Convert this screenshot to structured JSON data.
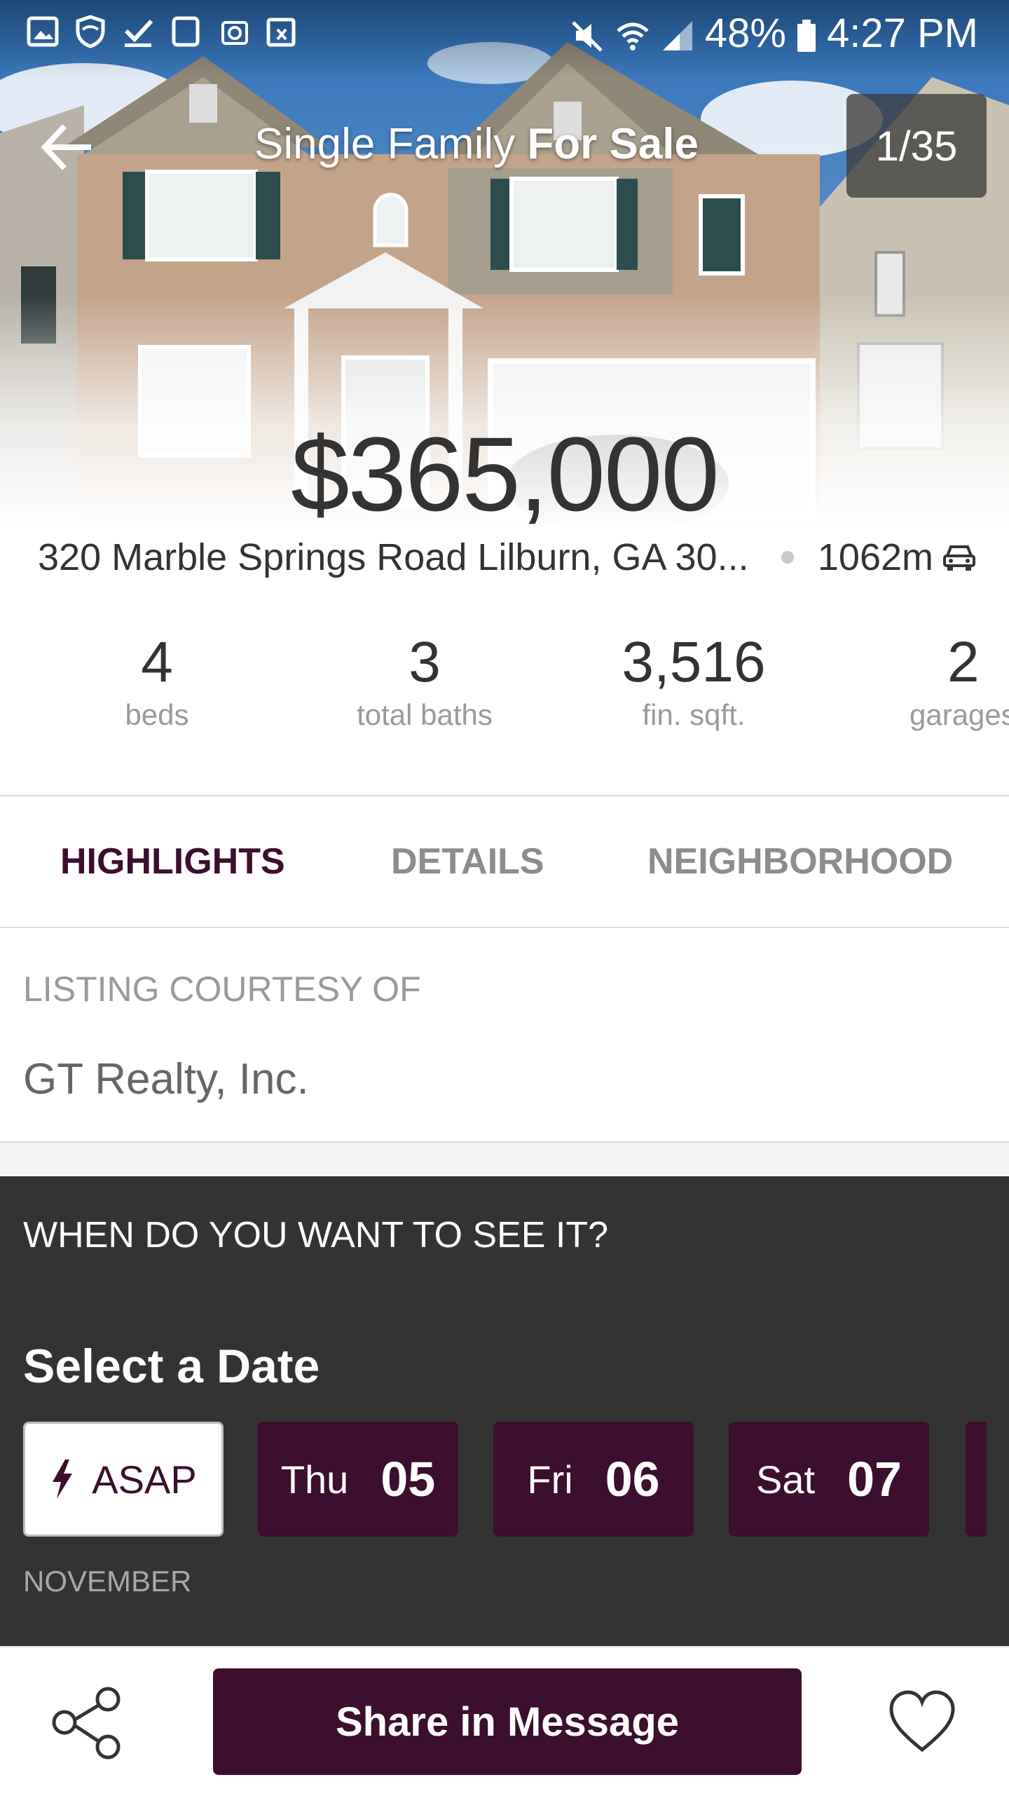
{
  "status_bar": {
    "battery": "48%",
    "time": "4:27 PM",
    "left_icons": [
      "gallery-icon",
      "shield-icon",
      "checkmark-icon",
      "device-icon",
      "email-icon",
      "calendar-icon"
    ],
    "right_icons": [
      "mute-icon",
      "wifi-icon",
      "signal-icon",
      "battery-icon"
    ]
  },
  "header": {
    "title_regular": "Single Family ",
    "title_bold": "For Sale",
    "photo_counter": "1/35"
  },
  "listing": {
    "price": "$365,000",
    "address": "320 Marble Springs Road Lilburn, GA 30...",
    "distance": "1062m"
  },
  "stats": [
    {
      "value": "4",
      "label": "beds"
    },
    {
      "value": "3",
      "label": "total baths"
    },
    {
      "value": "3,516",
      "label": "fin. sqft."
    },
    {
      "value": "2",
      "label": "garages"
    }
  ],
  "tabs": [
    {
      "label": "HIGHLIGHTS",
      "active": true
    },
    {
      "label": "DETAILS",
      "active": false
    },
    {
      "label": "NEIGHBORHOOD",
      "active": false
    }
  ],
  "courtesy": {
    "label": "LISTING COURTESY OF",
    "value": "GT Realty, Inc."
  },
  "schedule": {
    "question": "WHEN DO YOU WANT TO SEE IT?",
    "select_label": "Select a Date",
    "asap_label": "ASAP",
    "dates": [
      {
        "day": "Thu",
        "num": "05"
      },
      {
        "day": "Fri",
        "num": "06"
      },
      {
        "day": "Sat",
        "num": "07"
      }
    ],
    "month": "NOVEMBER"
  },
  "bottom_bar": {
    "primary_button": "Share in Message"
  },
  "colors": {
    "accent": "#3b0f2d",
    "tab_active": "#3d0f2e",
    "schedule_bg": "#333333"
  }
}
